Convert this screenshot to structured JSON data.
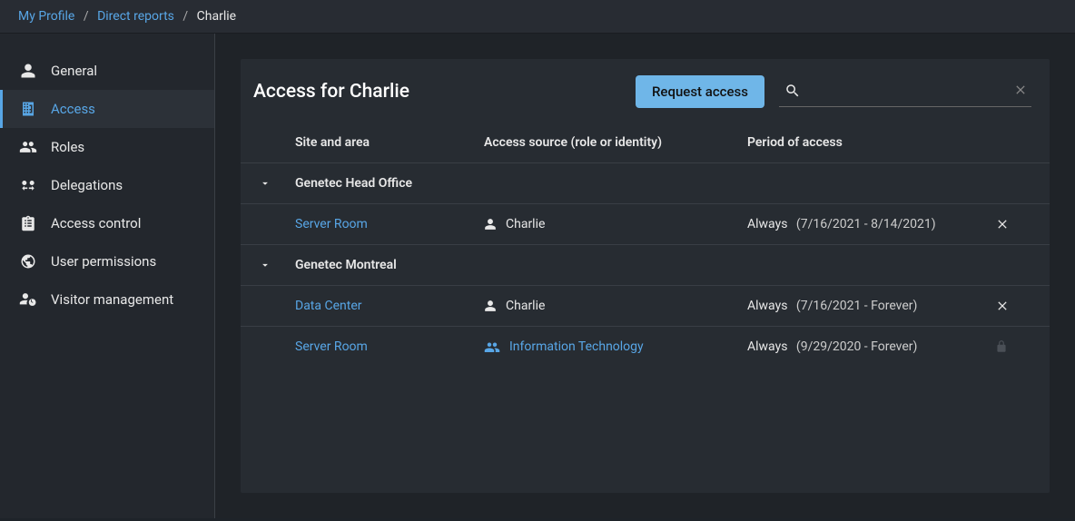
{
  "breadcrumb": {
    "items": [
      {
        "label": "My Profile",
        "link": true
      },
      {
        "label": "Direct reports",
        "link": true
      },
      {
        "label": "Charlie",
        "link": false
      }
    ]
  },
  "sidebar": {
    "items": [
      {
        "id": "general",
        "label": "General",
        "icon": "person-icon"
      },
      {
        "id": "access",
        "label": "Access",
        "icon": "building-icon",
        "active": true
      },
      {
        "id": "roles",
        "label": "Roles",
        "icon": "users-icon"
      },
      {
        "id": "delegations",
        "label": "Delegations",
        "icon": "exchange-icon"
      },
      {
        "id": "access-control",
        "label": "Access control",
        "icon": "clipboard-icon"
      },
      {
        "id": "user-permissions",
        "label": "User permissions",
        "icon": "globe-icon"
      },
      {
        "id": "visitor-management",
        "label": "Visitor management",
        "icon": "person-clock-icon"
      }
    ]
  },
  "panel": {
    "title": "Access for Charlie",
    "request_button": "Request access",
    "search_placeholder": ""
  },
  "table": {
    "headers": {
      "site": "Site and area",
      "source": "Access source (role or identity)",
      "period": "Period of access"
    },
    "groups": [
      {
        "name": "Genetec Head Office",
        "rows": [
          {
            "site": "Server Room",
            "source": {
              "type": "identity",
              "label": "Charlie"
            },
            "period_mode": "Always",
            "period_range": "(7/16/2021 - 8/14/2021)",
            "action": "delete"
          }
        ]
      },
      {
        "name": "Genetec Montreal",
        "rows": [
          {
            "site": "Data Center",
            "source": {
              "type": "identity",
              "label": "Charlie"
            },
            "period_mode": "Always",
            "period_range": "(7/16/2021 - Forever)",
            "action": "delete"
          },
          {
            "site": "Server Room",
            "source": {
              "type": "role",
              "label": "Information Technology"
            },
            "period_mode": "Always",
            "period_range": "(9/29/2020 - Forever)",
            "action": "locked"
          }
        ]
      }
    ]
  }
}
